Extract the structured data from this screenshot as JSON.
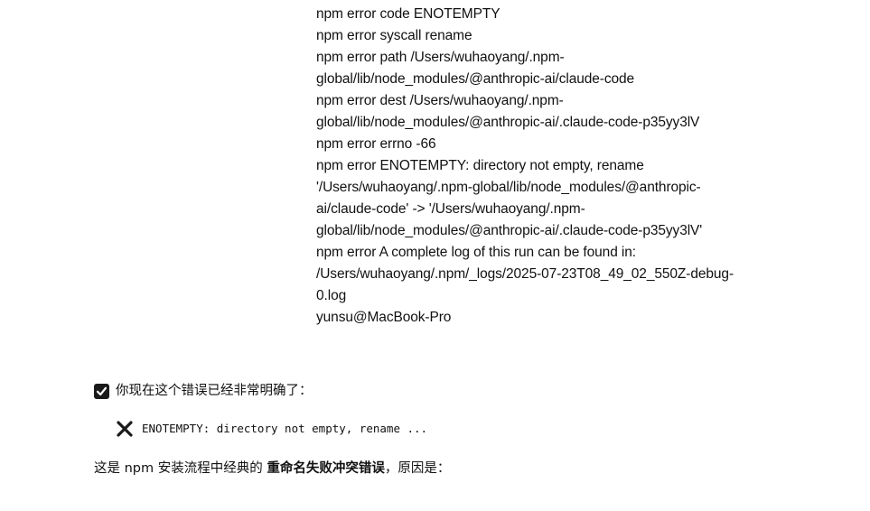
{
  "terminal_log": {
    "lines": [
      "npm error code ENOTEMPTY",
      "npm error syscall rename",
      "npm error path /Users/wuhaoyang/.npm-",
      "global/lib/node_modules/@anthropic-ai/claude-code",
      "npm error dest /Users/wuhaoyang/.npm-",
      "global/lib/node_modules/@anthropic-ai/.claude-code-p35yy3lV",
      "npm error errno -66",
      "npm error ENOTEMPTY: directory not empty, rename",
      "'/Users/wuhaoyang/.npm-global/lib/node_modules/@anthropic-",
      "ai/claude-code' -> '/Users/wuhaoyang/.npm-",
      "global/lib/node_modules/@anthropic-ai/.claude-code-p35yy3lV'",
      "npm error A complete log of this run can be found in:",
      "/Users/wuhaoyang/.npm/_logs/2025-07-23T08_49_02_550Z-debug-",
      "0.log",
      "yunsu@MacBook-Pro"
    ]
  },
  "summary": {
    "icon": "check-box-icon",
    "text": "你现在这个错误已经非常明确了："
  },
  "error_item": {
    "icon": "cross-icon",
    "code_text": "ENOTEMPTY: directory not empty, rename ..."
  },
  "explanation": {
    "prefix": "这是 npm 安装流程中经典的 ",
    "bold": "重命名失败冲突错误",
    "suffix": "，原因是："
  }
}
